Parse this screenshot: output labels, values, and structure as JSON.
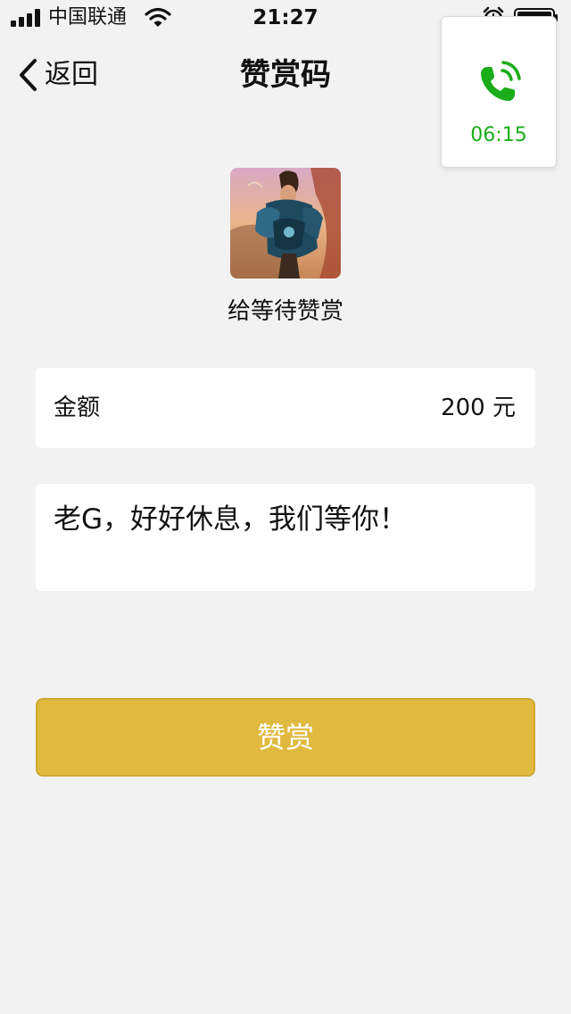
{
  "status_bar": {
    "carrier": "中国联通",
    "time": "21:27"
  },
  "nav": {
    "back_label": "返回",
    "title": "赞赏码"
  },
  "call_widget": {
    "duration": "06:15",
    "accent_color": "#1aad19"
  },
  "recipient": {
    "label": "给等待赞赏"
  },
  "amount": {
    "label": "金额",
    "value": "200 元"
  },
  "message": {
    "text": "老G，好好休息，我们等你！"
  },
  "submit": {
    "label": "赞赏",
    "color": "#e0b93f"
  }
}
